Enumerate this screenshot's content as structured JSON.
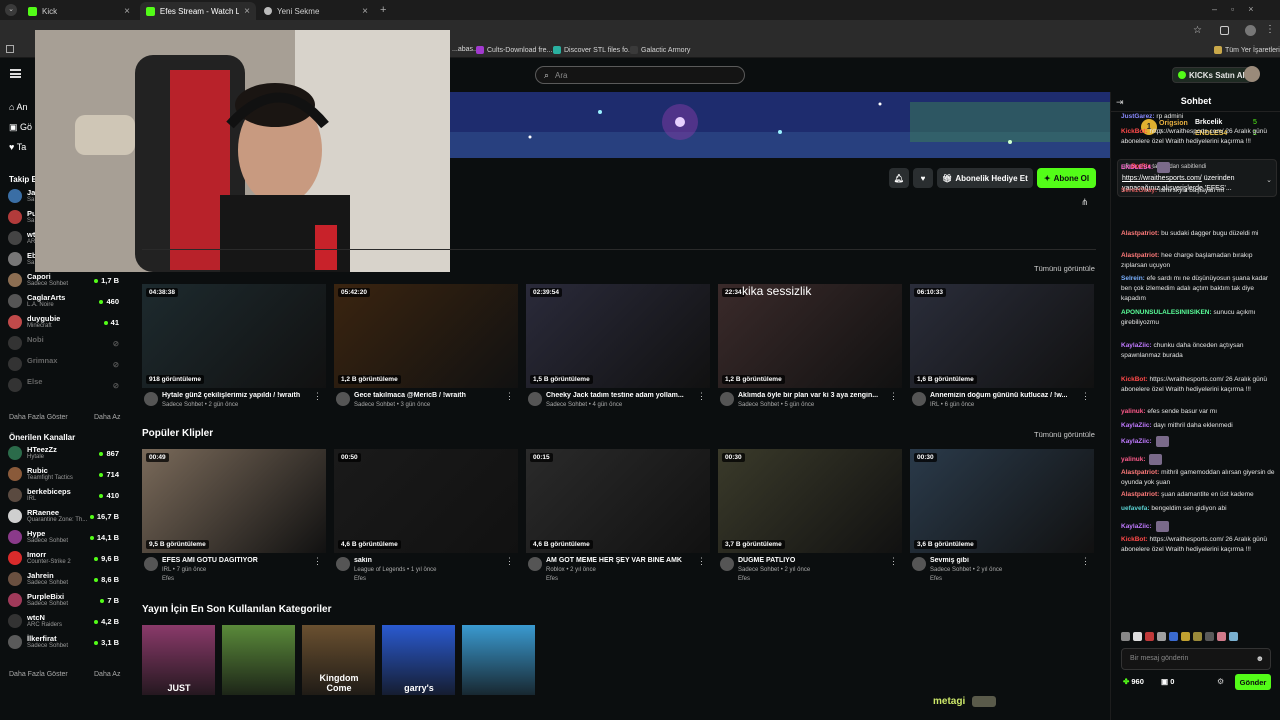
{
  "browser": {
    "tabs": [
      {
        "label": "Kick",
        "active": false
      },
      {
        "label": "Efes Stream - Watch Live on Ki...",
        "active": true
      },
      {
        "label": "Yeni Sekme",
        "active": false
      }
    ],
    "bookmarks": [
      "...abas...",
      "Cults-Download fre...",
      "Discover STL files fo...",
      "Galactic Armory"
    ],
    "bookmarks_folder": "Tüm Yer İşaretleri"
  },
  "header": {
    "search_placeholder": "Ara",
    "buy_kicks_label": "KICKs Satın Al"
  },
  "sidebar": {
    "nav": [
      "An",
      "Gö",
      "Ta"
    ],
    "following_title": "Takip Ed",
    "following": [
      {
        "name": "Ja",
        "sub": "Sa",
        "count": "",
        "color": "#3a6ea5",
        "offline": false
      },
      {
        "name": "Pu",
        "sub": "Sa",
        "count": "",
        "color": "#b23b3b",
        "offline": false
      },
      {
        "name": "wt",
        "sub": "AR",
        "count": "",
        "color": "#444",
        "offline": false
      },
      {
        "name": "Eb",
        "sub": "Sa",
        "count": "",
        "color": "#777",
        "offline": false
      },
      {
        "name": "Capori",
        "sub": "Sadece Sohbet",
        "count": "1,7 B",
        "color": "#8c6e52",
        "offline": false
      },
      {
        "name": "CaglarArts",
        "sub": "L.A. Noire",
        "count": "460",
        "color": "#555",
        "offline": false
      },
      {
        "name": "duygubie",
        "sub": "Minecraft",
        "count": "41",
        "color": "#c04a4a",
        "offline": false
      },
      {
        "name": "Nobi",
        "sub": "",
        "count": "",
        "color": "#333",
        "offline": true
      },
      {
        "name": "Grimnax",
        "sub": "",
        "count": "",
        "color": "#333",
        "offline": true
      },
      {
        "name": "Else",
        "sub": "",
        "count": "",
        "color": "#333",
        "offline": true
      }
    ],
    "show_more": "Daha Fazla Göster",
    "show_less": "Daha Az",
    "recommended_title": "Önerilen Kanallar",
    "recommended": [
      {
        "name": "HTeezZz",
        "sub": "Hytale",
        "count": "867",
        "color": "#2b6b4a"
      },
      {
        "name": "Rubic",
        "sub": "Teamfight Tactics",
        "count": "714",
        "color": "#8a5a3a"
      },
      {
        "name": "berkebiceps",
        "sub": "IRL",
        "count": "410",
        "color": "#5a4a40"
      },
      {
        "name": "RRaenee",
        "sub": "Quarantine Zone: Th...",
        "count": "16,7 B",
        "color": "#cfcfcf"
      },
      {
        "name": "Hype",
        "sub": "Sadece Sohbet",
        "count": "14,1 B",
        "color": "#8a3a8a"
      },
      {
        "name": "Imorr",
        "sub": "Counter-Strike 2",
        "count": "9,6 B",
        "color": "#d92b2b"
      },
      {
        "name": "Jahrein",
        "sub": "Sadece Sohbet",
        "count": "8,6 B",
        "color": "#6a5040"
      },
      {
        "name": "PurpleBixi",
        "sub": "Sadece Sohbet",
        "count": "7 B",
        "color": "#a03a5a"
      },
      {
        "name": "wtcN",
        "sub": "ARC Raiders",
        "count": "4,2 B",
        "color": "#333"
      },
      {
        "name": "İlkerfirat",
        "sub": "Sadece Sohbet",
        "count": "3,1 B",
        "color": "#5a5a5a"
      }
    ],
    "show_more_2": "Daha Fazla Göster",
    "show_less_2": "Daha Az"
  },
  "actions": {
    "gift_label": "Abonelik Hediye Et",
    "subscribe_label": "Abone Ol"
  },
  "videos": {
    "see_all": "Tümünü görüntüle",
    "items": [
      {
        "duration": "04:38:38",
        "views": "918 görüntüleme",
        "title": "Hytale gün2 çekilişlerimiz yapıldı / !wraith",
        "category": "Sadece Sohbet",
        "age": "2 gün önce",
        "bg": "#1d2a2e"
      },
      {
        "duration": "05:42:20",
        "views": "1,2 B görüntüleme",
        "title": "Gece takılmaca @MericB / !wraith",
        "category": "Sadece Sohbet",
        "age": "3 gün önce",
        "bg": "#3a2410"
      },
      {
        "duration": "02:39:54",
        "views": "1,5 B görüntüleme",
        "title": "Cheeky Jack tadım testine adam yollam...",
        "category": "Sadece Sohbet",
        "age": "4 gün önce",
        "bg": "#2a2a3a"
      },
      {
        "duration": "22:34",
        "views": "1,2 B görüntüleme",
        "title": "Aklımda öyle bir plan var ki 3 aya zengin...",
        "category": "Sadece Sohbet",
        "age": "5 gün önce",
        "bg": "#3a2a2a",
        "overlay": "kika sessizlik"
      },
      {
        "duration": "06:10:33",
        "views": "1,6 B görüntüleme",
        "title": "Annemizin doğum gününü kutlucaz / !w...",
        "category": "IRL",
        "age": "6 gün önce",
        "bg": "#2a2d3a"
      }
    ]
  },
  "clips": {
    "title": "Popüler Klipler",
    "see_all": "Tümünü görüntüle",
    "items": [
      {
        "duration": "00:49",
        "views": "9,5 B görüntüleme",
        "title": "EFES AMI GÖTÜ DAĞITIYOR",
        "category": "IRL",
        "age": "7 gün önce",
        "author": "Efes",
        "bg": "#7a6a5a"
      },
      {
        "duration": "00:50",
        "views": "4,6 B görüntüleme",
        "title": "sakin",
        "category": "League of Legends",
        "age": "1 yıl önce",
        "author": "Efes",
        "bg": "#1a1a1a"
      },
      {
        "duration": "00:15",
        "views": "4,6 B görüntüleme",
        "title": "AM GOT MEME HER ŞEY VAR BİNE AMK",
        "category": "Roblox",
        "age": "2 yıl önce",
        "author": "Efes",
        "bg": "#2a2a2a"
      },
      {
        "duration": "00:30",
        "views": "3,7 B görüntüleme",
        "title": "DÜĞME PATLIYO",
        "category": "Sadece Sohbet",
        "age": "2 yıl önce",
        "author": "Efes",
        "bg": "#3a3a2a"
      },
      {
        "duration": "00:30",
        "views": "3,6 B görüntüleme",
        "title": "Sevmiş gibi",
        "category": "Sadece Sohbet",
        "age": "2 yıl önce",
        "author": "Efes",
        "bg": "#2a3a4a"
      }
    ]
  },
  "categories": {
    "title": "Yayın İçin En Son Kullanılan Kategoriler",
    "items": [
      {
        "label": "JUST",
        "bg": "#8a3a6a"
      },
      {
        "label": "",
        "bg": "#5a8a3a"
      },
      {
        "label": "Kingdom Come",
        "bg": "#6a5030"
      },
      {
        "label": "garry's",
        "bg": "#2a5ad0"
      },
      {
        "label": "",
        "bg": "#3a9ad0"
      }
    ]
  },
  "chat": {
    "title": "Sohbet",
    "leaderboard": [
      {
        "name": "Origsion",
        "value": "7"
      },
      {
        "name": "Brkcelik",
        "value": "5"
      },
      {
        "name": "ENDLES4",
        "value": "1"
      }
    ],
    "pinned_by": "BotRix",
    "pinned_suffix": "tarafından sabitlendi",
    "pinned_link": "https://wraithesports.com/",
    "pinned_text": "üzerinden yapacağınız alışverişlerde 'EFES'...",
    "messages": [
      {
        "user": "JustGarez:",
        "text": "rp admini",
        "color": "#8a8aff"
      },
      {
        "user": "KickBot:",
        "text": "https://wraithesports.com/ 26 Aralık günü abonelere özel Wraith hediyelerini kaçırma !!!",
        "color": "#ff4a4a"
      },
      {
        "user": "ENDLES4:",
        "text": "",
        "color": "#ff6ad0"
      },
      {
        "user": "SerezGiray:",
        "text": "İsmi skyla başlayan mı",
        "color": "#d05a5a"
      },
      {
        "user": "Alastpatriot:",
        "text": "bu sudaki dagger bugu düzeldi mi",
        "color": "#ff7a7a"
      },
      {
        "user": "Alastpatriot:",
        "text": "hee charge başlamadan bırakıp zıplarsan uçuyon",
        "color": "#ff7a7a"
      },
      {
        "user": "Selrein:",
        "text": "efe sardı mı ne düşünüyosun şuana kadar ben çok izlemedim adalı açtım baktım tak diye kapadım",
        "color": "#7ab0ff"
      },
      {
        "user": "APONUNSULALESINIISIKEN:",
        "text": "sunucu açıkmı girebiliyozmu",
        "color": "#5aff9a"
      },
      {
        "user": "KaylaZiic:",
        "text": "chunku daha önceden açtıysan spawnlanmaz burada",
        "color": "#c07aff"
      },
      {
        "user": "KickBot:",
        "text": "https://wraithesports.com/ 26 Aralık günü abonelere özel Wraith hediyelerini kaçırma !!!",
        "color": "#ff4a4a"
      },
      {
        "user": "yalinuk:",
        "text": "efes sende basur var mı",
        "color": "#ff5a8a"
      },
      {
        "user": "KaylaZiic:",
        "text": "dayı mithril daha eklenmedi",
        "color": "#c07aff"
      },
      {
        "user": "KaylaZiic:",
        "text": "",
        "color": "#c07aff"
      },
      {
        "user": "yalinuk:",
        "text": "",
        "color": "#ff5a8a"
      },
      {
        "user": "Alastpatriot:",
        "text": "mithril gamemoddan alırsan giyersin de oyunda yok şuan",
        "color": "#ff7a7a"
      },
      {
        "user": "Alastpatriot:",
        "text": "şuan adamantite en üst kademe",
        "color": "#ff7a7a"
      },
      {
        "user": "uefavefa:",
        "text": "bengeldim sen gidiyon abi",
        "color": "#5ad0d0"
      },
      {
        "user": "KaylaZiic:",
        "text": "",
        "color": "#c07aff"
      },
      {
        "user": "KickBot:",
        "text": "https://wraithesports.com/ 26 Aralık günü abonelere özel Wraith hediyelerini kaçırma !!!",
        "color": "#ff4a4a"
      }
    ],
    "input_placeholder": "Bir mesaj gönderin",
    "points": "960",
    "gifts": "0",
    "send_label": "Gönder"
  },
  "overlay_text": "metagi",
  "colors": {
    "accent": "#53fc18",
    "bg": "#0b0e0f"
  }
}
